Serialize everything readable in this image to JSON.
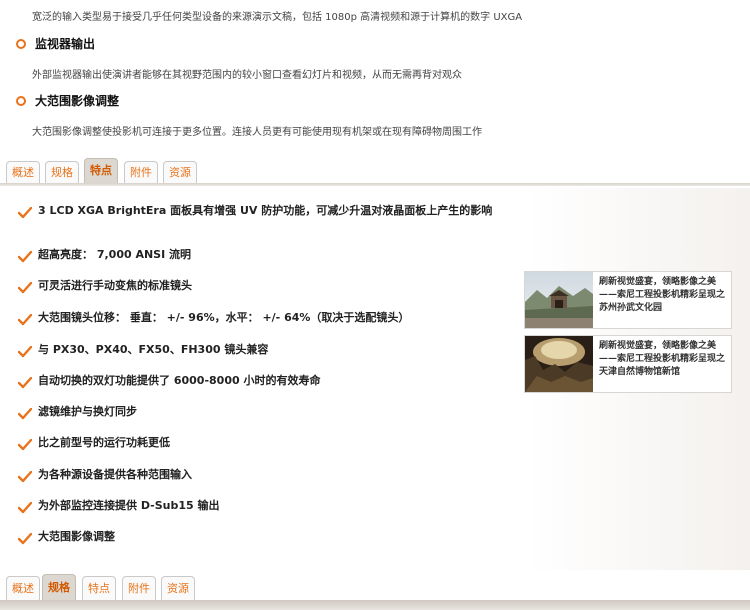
{
  "top": {
    "intro_text": "宽泛的输入类型易于接受几乎任何类型设备的来源演示文稿，包括 1080p 高清视频和源于计算机的数字 UXGA",
    "sections": [
      {
        "title": "监视器输出",
        "text": "外部监视器输出使演讲者能够在其视野范围内的较小窗口查看幻灯片和视频，从而无需再背对观众"
      },
      {
        "title": "大范围影像调整",
        "text": "大范围影像调整使投影机可连接于更多位置。连接人员更有可能使用现有机架或在现有障碍物周围工作"
      }
    ]
  },
  "tabs_top": {
    "items": [
      "概述",
      "规格",
      "特点",
      "附件",
      "资源"
    ],
    "active": "特点"
  },
  "features": [
    "3 LCD XGA BrightEra 面板具有增强  UV 防护功能，可减少升温对液晶面板上产生的影响",
    "超高亮度：  7,000 ANSI 流明",
    "可灵活进行手动变焦的标准镜头",
    "大范围镜头位移：  垂直：  +/- 96%，水平：  +/- 64%（取决于选配镜头）",
    "与  PX30、PX40、FX50、FH300 镜头兼容",
    "自动切换的双灯功能提供了  6000-8000 小时的有效寿命",
    "滤镜维护与换灯同步",
    "比之前型号的运行功耗更低",
    "为各种源设备提供各种范围输入",
    "为外部监控连接提供  D-Sub15 输出",
    "大范围影像调整"
  ],
  "news": [
    {
      "text": "刷新视觉盛宴，领略影像之美——索尼工程投影机精彩呈现之苏州孙武文化园"
    },
    {
      "text": "刷新视觉盛宴，领略影像之美 ——索尼工程投影机精彩呈现之天津自然博物馆新馆"
    }
  ],
  "tabs_bottom": {
    "items": [
      "概述",
      "规格",
      "特点",
      "附件",
      "资源"
    ],
    "active": "规格"
  },
  "colors": {
    "accent": "#e8731a",
    "tab_active_bg": "#dcd7d0"
  }
}
